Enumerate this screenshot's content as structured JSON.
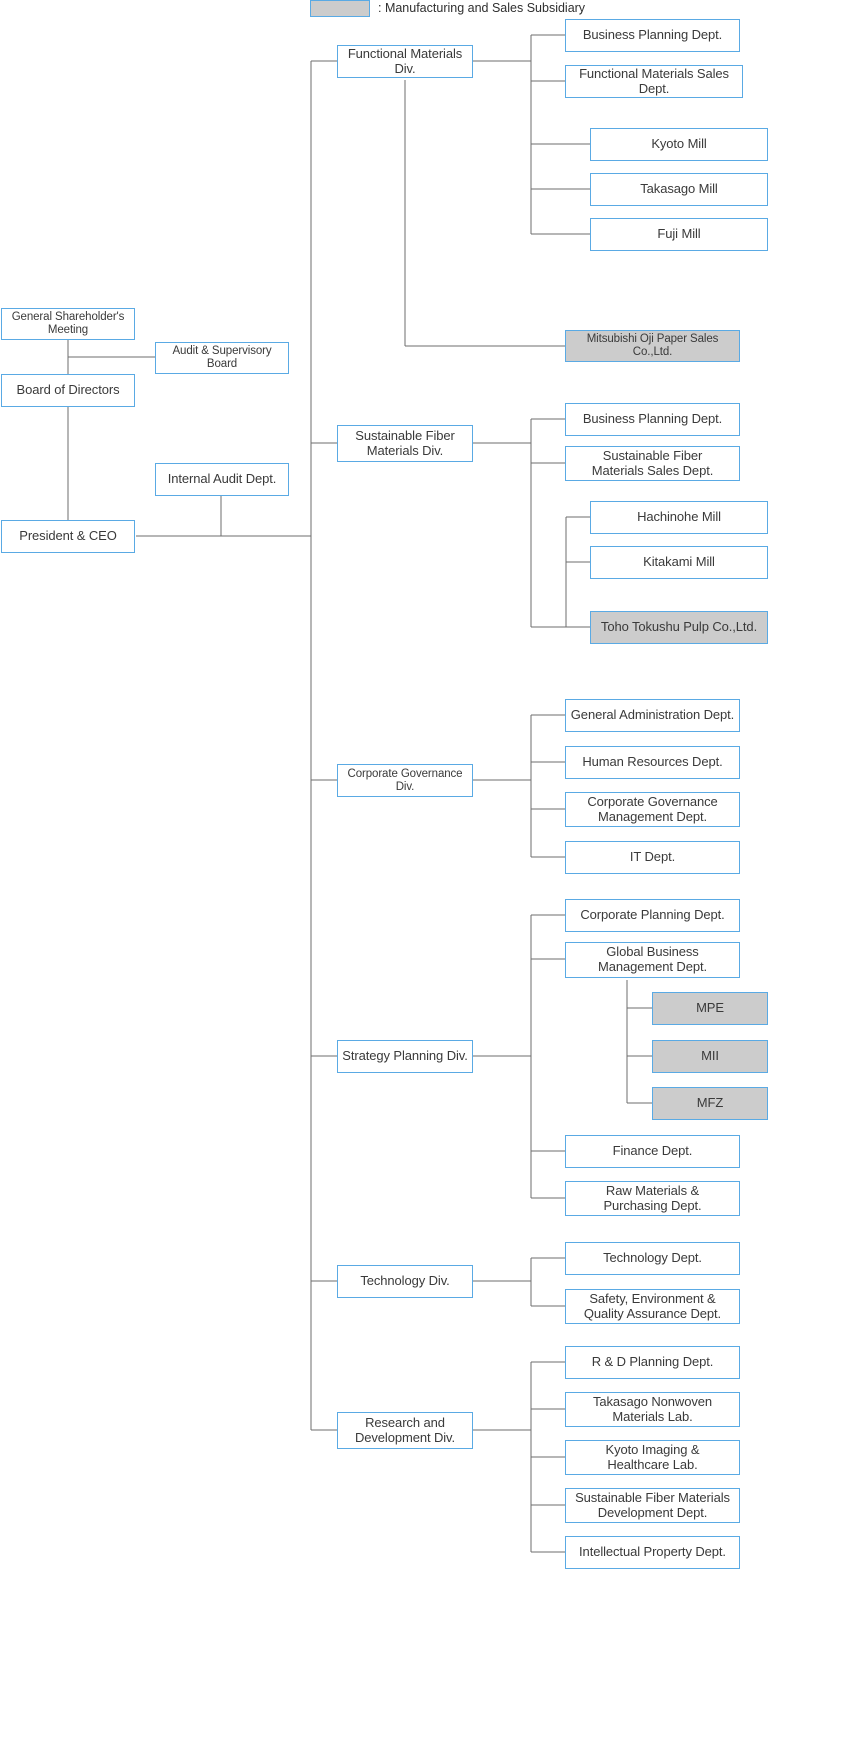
{
  "legend": {
    "swatch_color": "#cccccc",
    "border_color": "#5aaae4",
    "label": ": Manufacturing and Sales Subsidiary"
  },
  "governance": {
    "shareholders_meeting": "General Shareholder's Meeting",
    "audit_supervisory_board": "Audit & Supervisory Board",
    "board_of_directors": "Board of Directors",
    "internal_audit_dept": "Internal Audit Dept.",
    "president_ceo": "President & CEO"
  },
  "divisions": {
    "functional_materials": "Functional Materials  Div.",
    "sustainable_fiber": "Sustainable Fiber\nMaterials  Div.",
    "corporate_governance": "Corporate Governance Div.",
    "strategy_planning": "Strategy Planning Div.",
    "technology": "Technology Div.",
    "research_development": "Research and\nDevelopment Div."
  },
  "functional_materials_children": {
    "business_planning": "Business Planning Dept.",
    "sales_dept": "Functional Materials Sales Dept.",
    "kyoto_mill": "Kyoto Mill",
    "takasago_mill": "Takasago Mill",
    "fuji_mill": "Fuji  Mill",
    "mitsubishi_oji": "Mitsubishi Oji Paper Sales Co.,Ltd."
  },
  "sustainable_fiber_children": {
    "business_planning": "Business Planning Dept.",
    "sales_dept": "Sustainable Fiber\nMaterials Sales Dept.",
    "hachinohe_mill": "Hachinohe Mill",
    "kitakami_mill": "Kitakami Mill",
    "toho_tokushu": "Toho Tokushu Pulp Co.,Ltd."
  },
  "corporate_governance_children": {
    "general_administration": "General Administration Dept.",
    "human_resources": "Human Resources Dept.",
    "governance_management": "Corporate Governance\nManagement Dept.",
    "it_dept": "IT Dept."
  },
  "strategy_planning_children": {
    "corporate_planning": "Corporate Planning Dept.",
    "global_business": "Global Business\nManagement Dept.",
    "mpe": "MPE",
    "mii": "MII",
    "mfz": "MFZ",
    "finance": "Finance Dept.",
    "raw_materials": "Raw Materials &\nPurchasing Dept."
  },
  "technology_children": {
    "technology_dept": "Technology Dept.",
    "safety_environment": "Safety, Environment &\nQuality Assurance Dept."
  },
  "research_children": {
    "rd_planning": "R & D Planning Dept.",
    "takasago_nonwoven": "Takasago Nonwoven\nMaterials Lab.",
    "kyoto_imaging": "Kyoto Imaging &\nHealthcare Lab.",
    "sustainable_fiber_dev": "Sustainable Fiber Materials\nDevelopment Dept.",
    "intellectual_property": "Intellectual Property Dept."
  }
}
